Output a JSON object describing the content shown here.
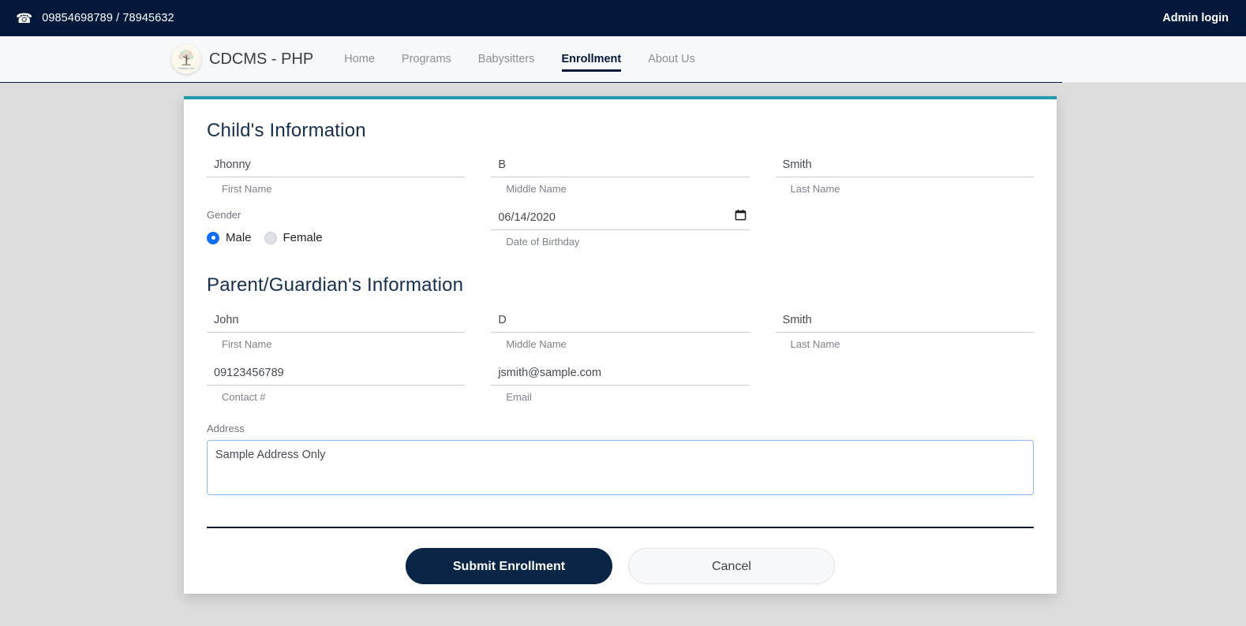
{
  "topbar": {
    "phone_icon": "phone-icon",
    "phone": "09854698789 / 78945632",
    "admin_login": "Admin login"
  },
  "navbar": {
    "logo_icon": "tree-logo-icon",
    "brand": "CDCMS - PHP",
    "items": [
      {
        "label": "Home",
        "active": false
      },
      {
        "label": "Programs",
        "active": false
      },
      {
        "label": "Babysitters",
        "active": false
      },
      {
        "label": "Enrollment",
        "active": true
      },
      {
        "label": "About Us",
        "active": false
      }
    ]
  },
  "form": {
    "child_section_title": "Child's Information",
    "child": {
      "first_name": {
        "value": "Jhonny",
        "help": "First Name",
        "placeholder": "First Name"
      },
      "middle_name": {
        "value": "B",
        "help": "Middle Name",
        "placeholder": "Middle Name"
      },
      "last_name": {
        "value": "Smith",
        "help": "Last Name",
        "placeholder": "Last Name"
      },
      "gender": {
        "label": "Gender",
        "options": [
          {
            "label": "Male",
            "selected": true
          },
          {
            "label": "Female",
            "selected": false
          }
        ]
      },
      "dob": {
        "value": "06/14/2020",
        "help": "Date of Birthday",
        "icon": "calendar-icon"
      }
    },
    "parent_section_title": "Parent/Guardian's Information",
    "parent": {
      "first_name": {
        "value": "John",
        "help": "First Name",
        "placeholder": "First Name"
      },
      "middle_name": {
        "value": "D",
        "help": "Middle Name",
        "placeholder": "Middle Name"
      },
      "last_name": {
        "value": "Smith",
        "help": "Last Name",
        "placeholder": "Last Name"
      },
      "contact": {
        "value": "09123456789",
        "help": "Contact #",
        "placeholder": "Contact #"
      },
      "email": {
        "value": "jsmith@sample.com",
        "help": "Email",
        "placeholder": "Email"
      }
    },
    "address": {
      "label": "Address",
      "value": "Sample Address Only",
      "placeholder": "Address"
    },
    "actions": {
      "submit_label": "Submit Enrollment",
      "cancel_label": "Cancel"
    }
  },
  "colors": {
    "topbar_bg": "#03193c",
    "navbar_bg": "#f7f8fa",
    "card_accent": "#2499ad",
    "page_bg": "#dcdcdc",
    "primary_button": "#0a2647",
    "radio_selected": "#0d6efd",
    "heading": "#14304f"
  }
}
